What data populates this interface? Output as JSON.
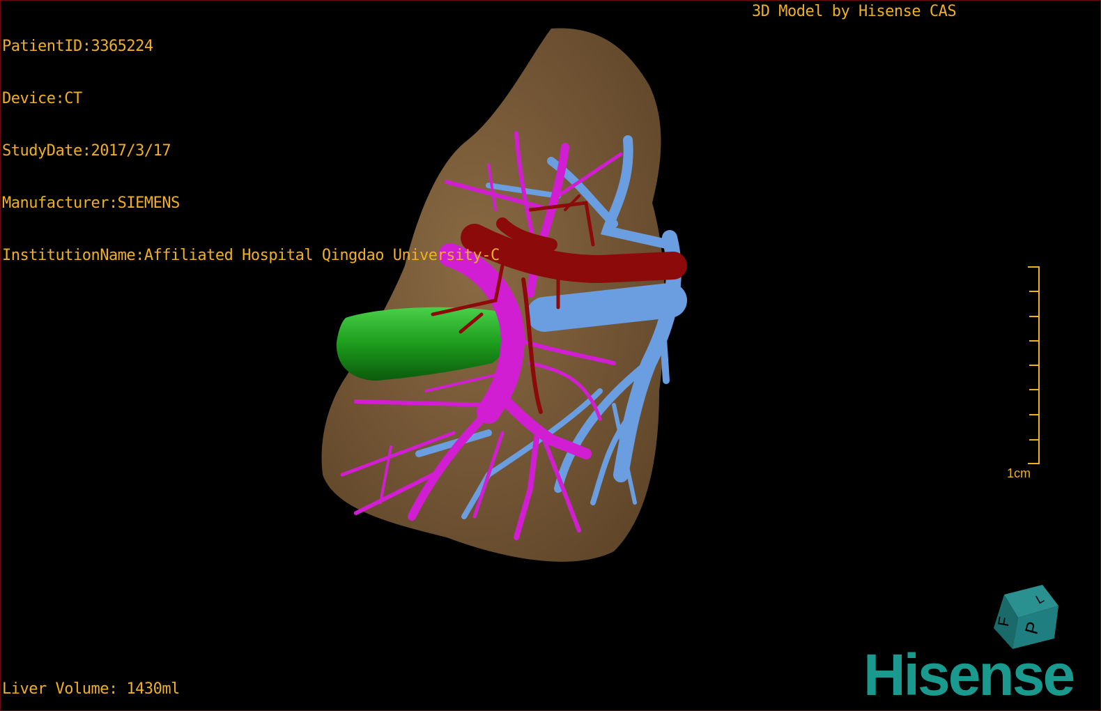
{
  "info": {
    "patient_id": "PatientID:3365224",
    "device": "Device:CT",
    "study_date": "StudyDate:2017/3/17",
    "manufacturer": "Manufacturer:SIEMENS",
    "institution": "InstitutionName:Affiliated Hospital Qingdao University-C"
  },
  "watermark": "3D Model by Hisense CAS",
  "liver_volume": "Liver Volume: 1430ml",
  "scale_bar": {
    "label": "1cm",
    "ticks": 9
  },
  "orientation_cube": {
    "faces": [
      "F",
      "L",
      "P"
    ],
    "color": "#1f7f80"
  },
  "logo": {
    "text": "Hisense",
    "color": "#1a9a8e"
  },
  "colors": {
    "text": "#f0b020",
    "liver": "#7a5a38",
    "gallbladder": "#1c9c1c",
    "portal_vein": "#d21ed2",
    "hepatic_vein": "#6a9ee0",
    "artery": "#8c0a0a"
  }
}
